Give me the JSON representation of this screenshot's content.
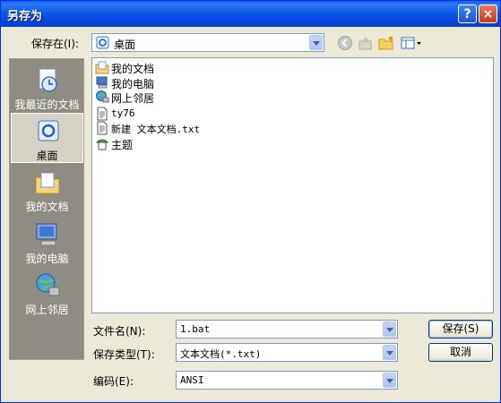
{
  "window": {
    "title": "另存为",
    "help_icon": "?",
    "close_icon": "×"
  },
  "save_in": {
    "label": "保存在(I):",
    "value": "桌面"
  },
  "places": [
    {
      "label": "我最近的文档",
      "icon": "recent-documents-icon"
    },
    {
      "label": "桌面",
      "icon": "desktop-icon",
      "selected": true
    },
    {
      "label": "我的文档",
      "icon": "my-documents-icon"
    },
    {
      "label": "我的电脑",
      "icon": "my-computer-icon"
    },
    {
      "label": "网上邻居",
      "icon": "network-places-icon"
    }
  ],
  "files": [
    {
      "name": "我的文档",
      "icon": "my-documents-icon"
    },
    {
      "name": "我的电脑",
      "icon": "my-computer-icon"
    },
    {
      "name": "网上邻居",
      "icon": "network-places-icon"
    },
    {
      "name": "ty76",
      "icon": "text-file-icon"
    },
    {
      "name": "新建 文本文档.txt",
      "icon": "text-file-icon"
    },
    {
      "name": "主题",
      "icon": "theme-icon"
    }
  ],
  "filename": {
    "label": "文件名(N):",
    "value": "1.bat"
  },
  "filetype": {
    "label": "保存类型(T):",
    "value": "文本文档(*.txt)"
  },
  "encoding": {
    "label": "编码(E):",
    "value": "ANSI"
  },
  "buttons": {
    "save": "保存(S)",
    "cancel": "取消"
  }
}
